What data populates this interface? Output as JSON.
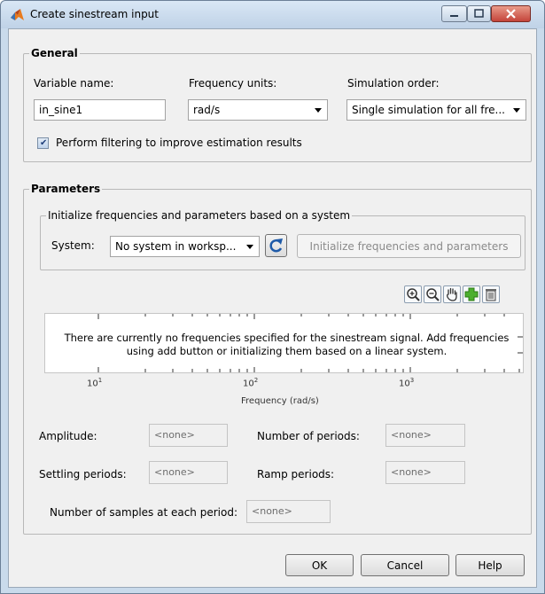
{
  "window": {
    "title": "Create sinestream input",
    "accent_color": "#c9daeb"
  },
  "general": {
    "title": "General",
    "variable_name_label": "Variable name:",
    "variable_name_value": "in_sine1",
    "frequency_units_label": "Frequency units:",
    "frequency_units_value": "rad/s",
    "simulation_order_label": "Simulation order:",
    "simulation_order_value": "Single simulation for all fre...",
    "filtering_checkbox_label": "Perform filtering to improve estimation results",
    "filtering_checked": true
  },
  "parameters": {
    "title": "Parameters",
    "init_group_title": "Initialize frequencies and parameters based on a system",
    "system_label": "System:",
    "system_value": "No system in worksp...",
    "init_button_label": "Initialize frequencies and parameters",
    "plot_message": "There are currently no frequencies specified for the sinestream signal. Add frequencies using add button or initializing them based on a linear system.",
    "plot_ticks": [
      {
        "base": "10",
        "exp": "1"
      },
      {
        "base": "10",
        "exp": "2"
      },
      {
        "base": "10",
        "exp": "3"
      }
    ],
    "plot_xlabel": "Frequency (rad/s)",
    "amplitude_label": "Amplitude:",
    "amplitude_value": "<none>",
    "num_periods_label": "Number of periods:",
    "num_periods_value": "<none>",
    "settling_label": "Settling periods:",
    "settling_value": "<none>",
    "ramp_label": "Ramp periods:",
    "ramp_value": "<none>",
    "samples_label": "Number of samples at each period:",
    "samples_value": "<none>"
  },
  "toolbar": {
    "icons": [
      "zoom-in-icon",
      "zoom-out-icon",
      "pan-hand-icon",
      "add-icon",
      "delete-icon"
    ]
  },
  "footer": {
    "ok_label": "OK",
    "cancel_label": "Cancel",
    "help_label": "Help"
  }
}
